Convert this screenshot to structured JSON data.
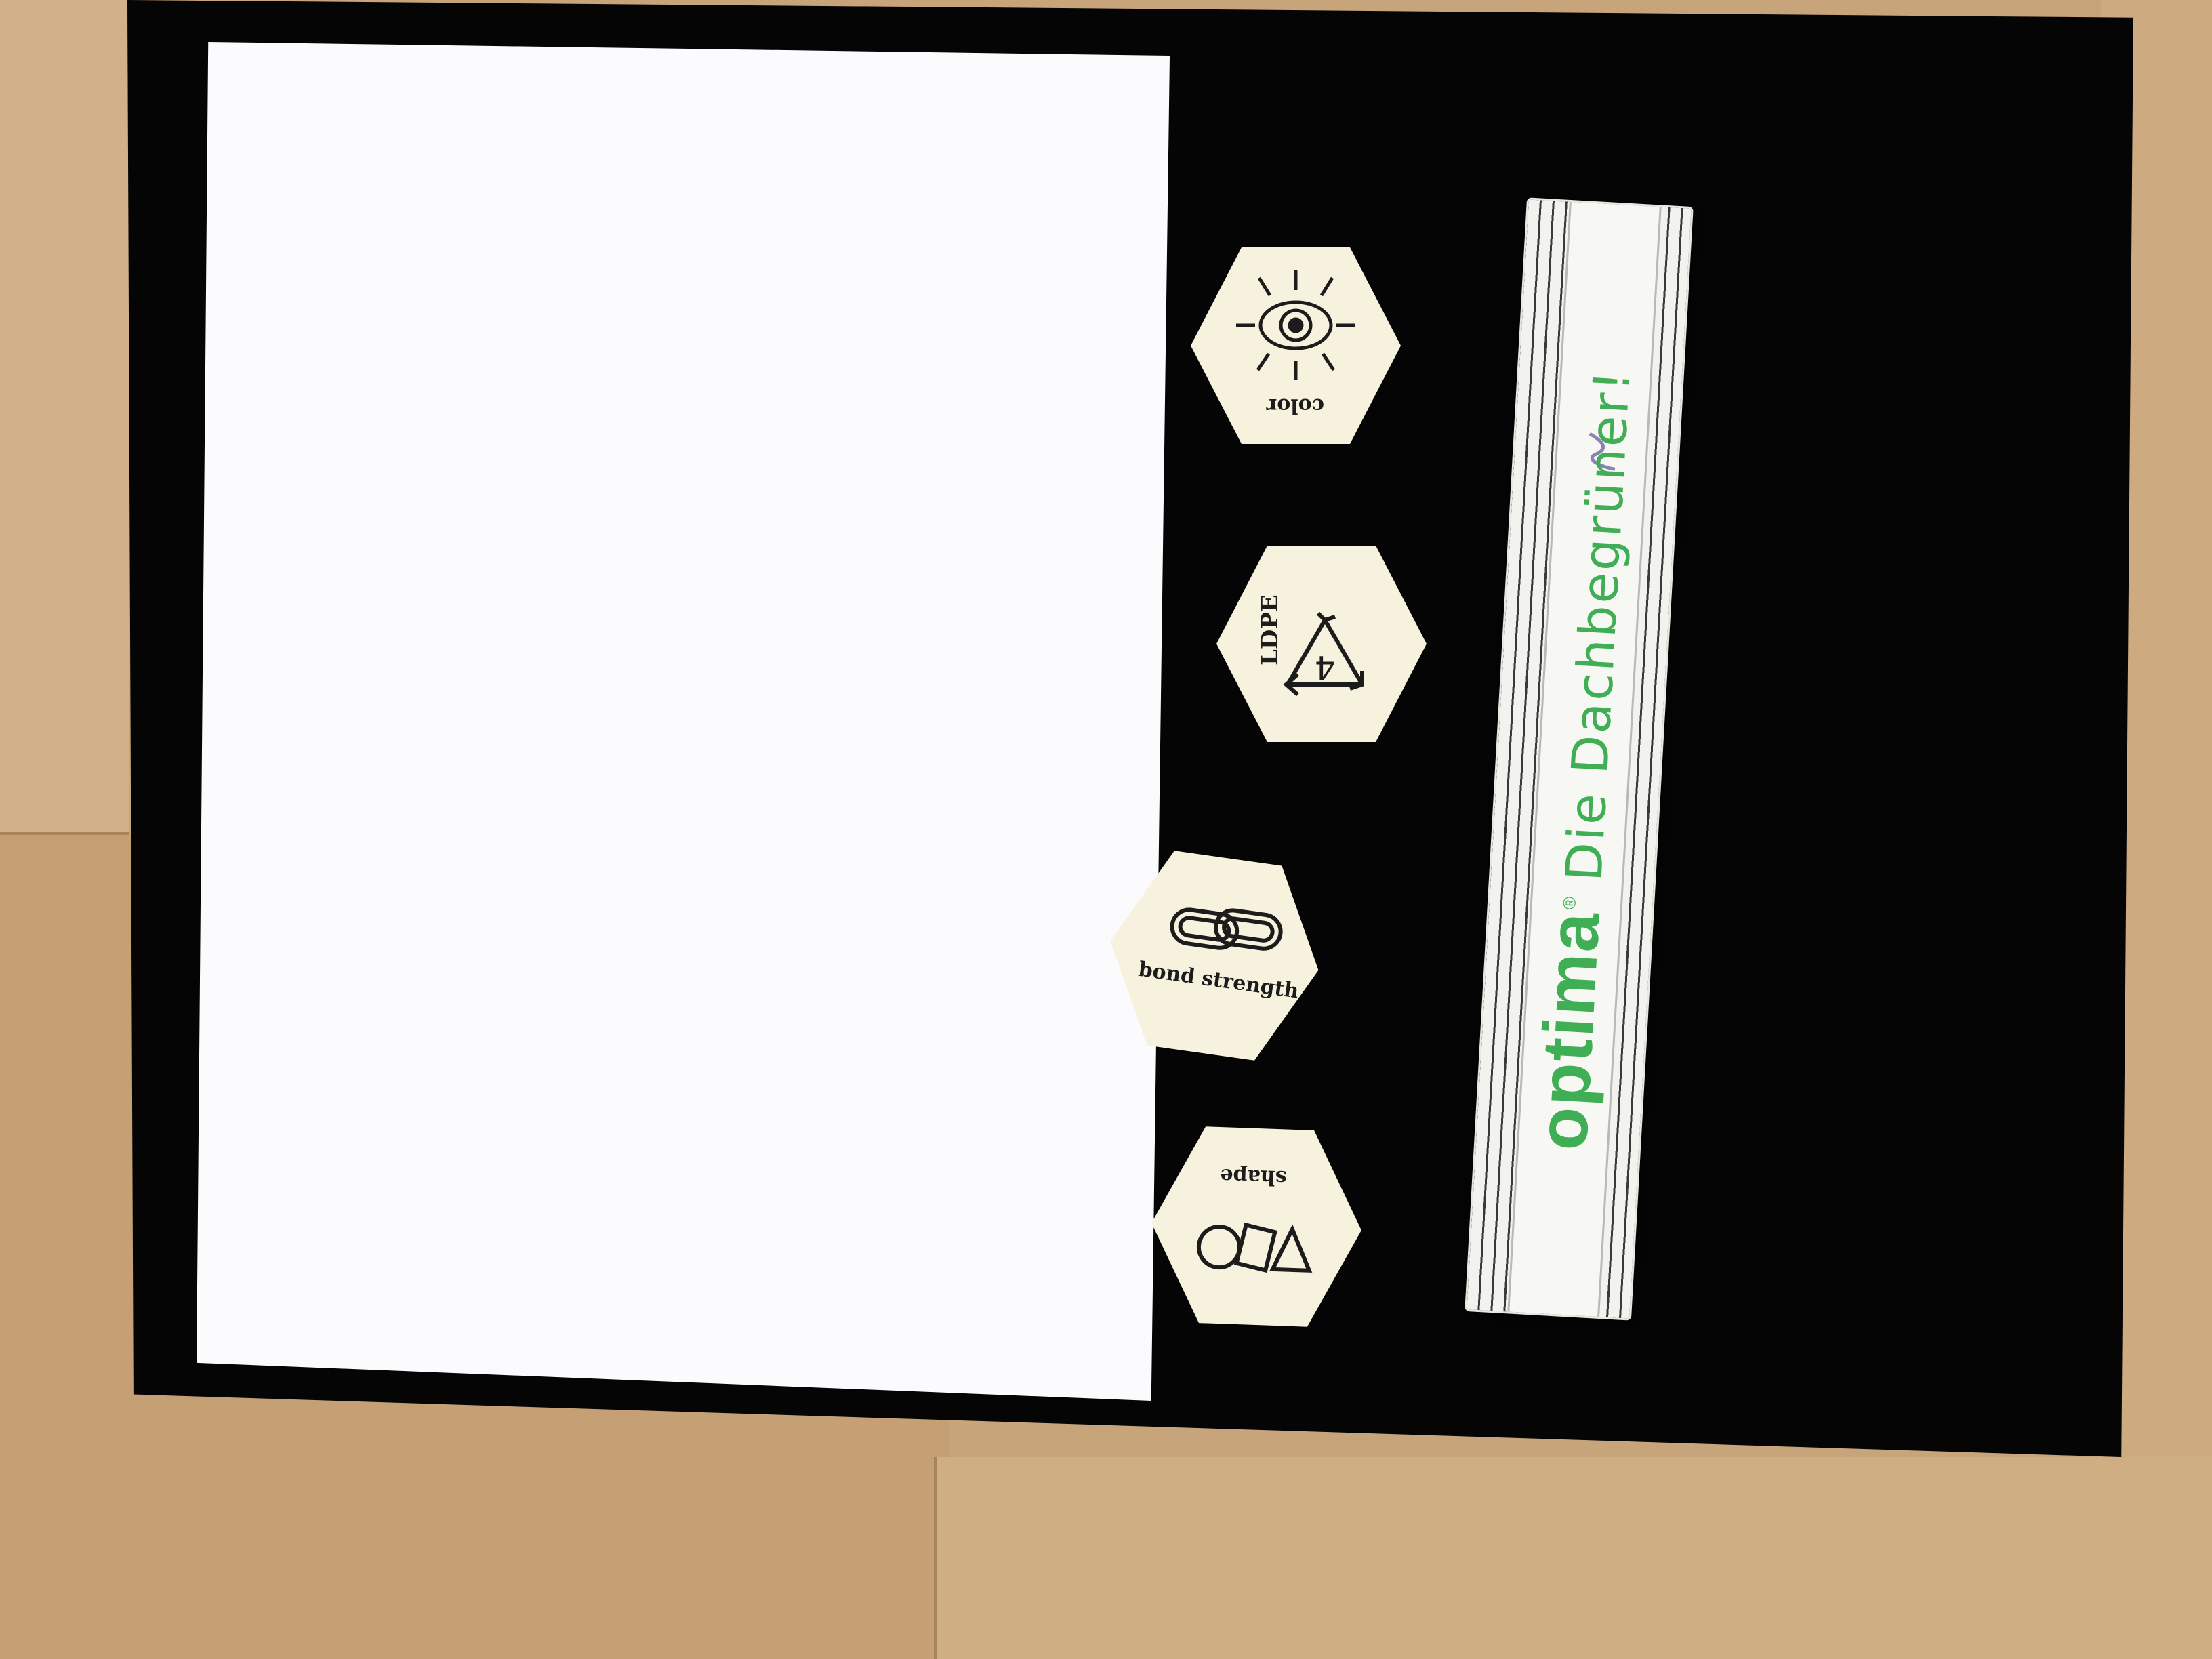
{
  "scene": {
    "description_colors": {
      "table_wood": "#c9a77c",
      "table_wood_dark": "#b08960",
      "board": "#050505",
      "paper": "#fbfbfd",
      "tile": "#f6f2dd",
      "tile_ink": "#1c1c1c",
      "ruler_green": "#3fae54"
    }
  },
  "tokens": [
    {
      "label": "color",
      "icon": "eye-icon"
    },
    {
      "label": "LDPE",
      "icon": "recycling-4-icon",
      "code": "4"
    },
    {
      "label": "bond strength",
      "icon": "chain-link-icon"
    },
    {
      "label": "shape",
      "icon": "shapes-icon"
    }
  ],
  "ruler": {
    "brand": "optima",
    "registered": "®",
    "slogan": "Die Dachbegrüner!"
  }
}
